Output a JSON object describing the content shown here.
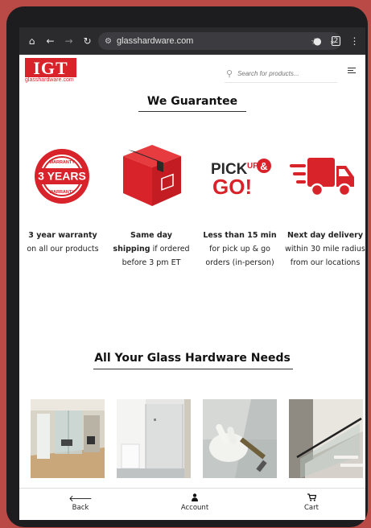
{
  "browser": {
    "url": "glasshardware.com",
    "icons": [
      "home-icon",
      "back-arrow-icon",
      "forward-arrow-icon",
      "reload-icon",
      "site-info-icon",
      "star-icon",
      "download-icon",
      "mic-icon",
      "tabs-icon",
      "more-icon"
    ],
    "tabs_count": "2"
  },
  "header": {
    "logo_text": "IGT",
    "logo_subtext": "glasshardware.com",
    "search_placeholder": "Search for products...",
    "brand_color": "#d8232a"
  },
  "guarantee": {
    "title": "We Guarantee",
    "badge_top": "WARRANTY",
    "badge_main": "3 YEARS",
    "badge_bottom": "WARRANTY",
    "pickup_logo_a": "PICK",
    "pickup_logo_b": "UP",
    "pickup_logo_c": "&",
    "pickup_logo_d": "GO!",
    "items": [
      {
        "bold": "3 year warranty",
        "rest": "on all our products",
        "icon": "warranty-badge-icon"
      },
      {
        "bold": "Same day shipping",
        "rest": "if ordered before 3 pm ET",
        "icon": "shipping-box-icon"
      },
      {
        "bold": "Less than 15 min",
        "rest": "for pick up & go orders (in-person)",
        "icon": "pickup-go-icon"
      },
      {
        "bold": "Next day delivery",
        "rest": "within 30 mile radius from our locations",
        "icon": "delivery-truck-icon"
      }
    ]
  },
  "hardware": {
    "title": "All Your Glass Hardware Needs",
    "photos": [
      "office-glass-partition-photo",
      "glass-shower-enclosure-photo",
      "gloved-hand-glass-tool-photo",
      "glass-staircase-railing-photo"
    ]
  },
  "bottom_nav": {
    "back": "Back",
    "account": "Account",
    "cart": "Cart"
  }
}
